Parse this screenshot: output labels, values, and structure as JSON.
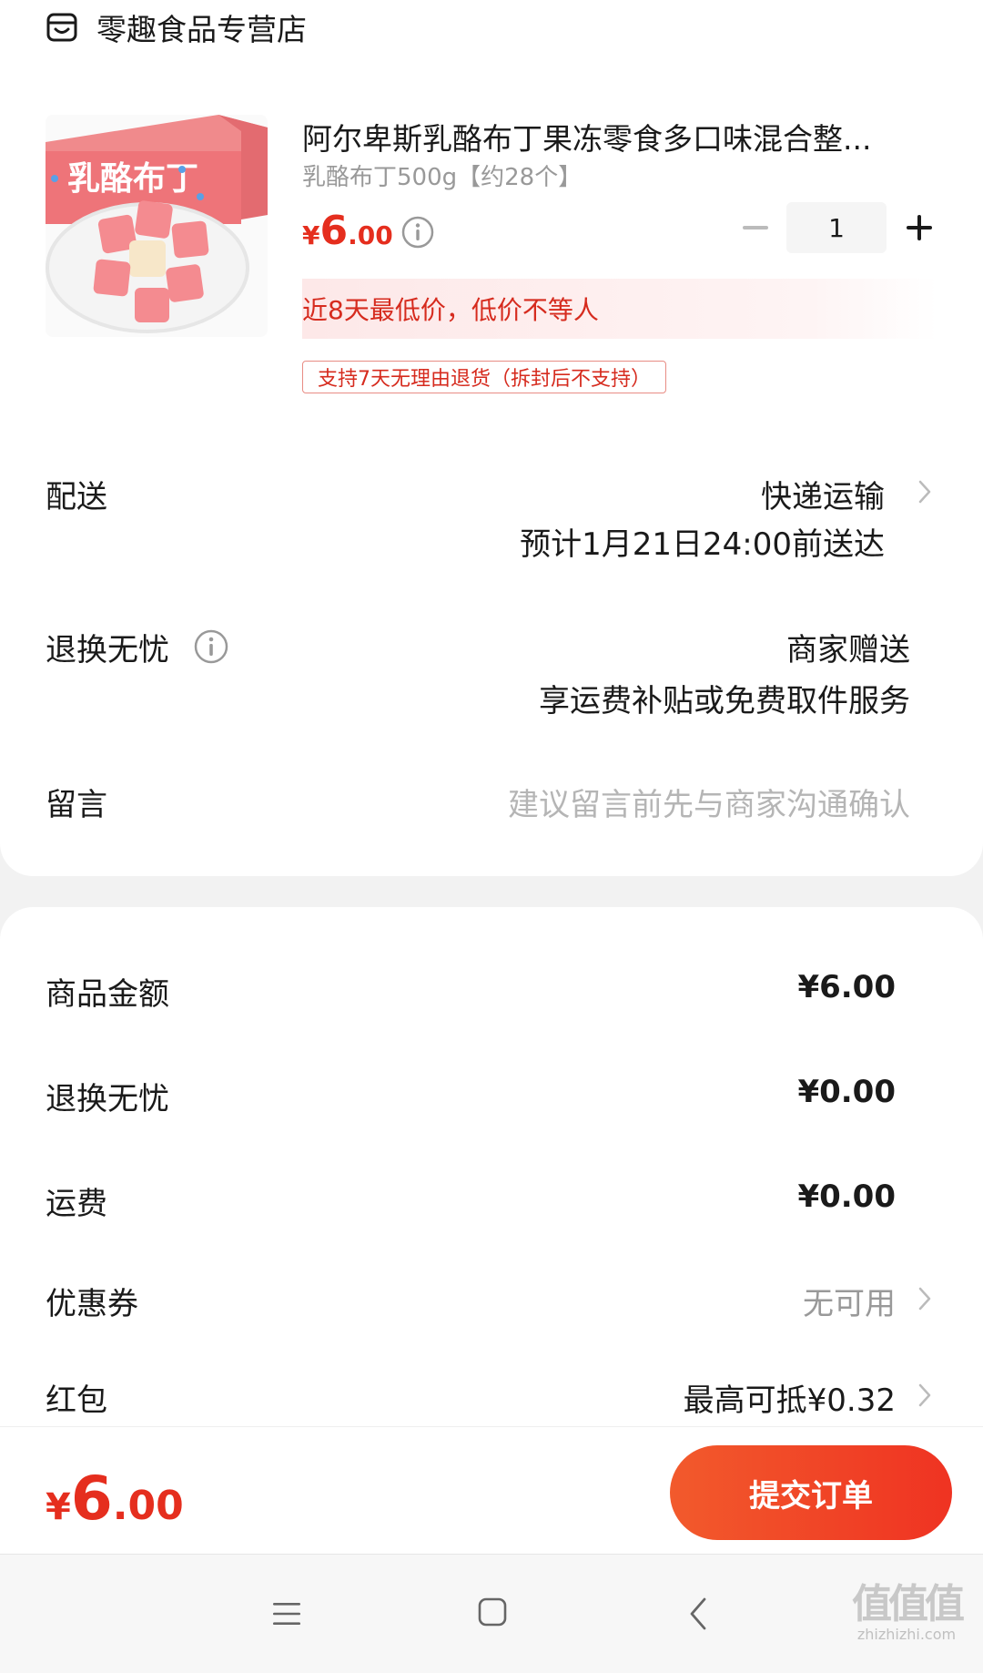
{
  "shop": {
    "name": "零趣食品专营店",
    "icon": "shop-icon"
  },
  "product": {
    "title": "阿尔卑斯乳酪布丁果冻零食多口味混合整...",
    "spec": "乳酪布丁500g【约28个】",
    "price": {
      "symbol": "¥",
      "integer": "6",
      "decimal": ".00"
    },
    "quantity": "1",
    "low_price_note": "近8天最低价，低价不等人",
    "return_badge": "支持7天无理由退货（拆封后不支持）",
    "image_texts": {
      "box_title": "乳酪布丁"
    }
  },
  "delivery": {
    "label": "配送",
    "method": "快递运输",
    "eta": "预计1月21日24:00前送达"
  },
  "return_service": {
    "label": "退换无忧",
    "value": "商家赠送",
    "desc": "享运费补贴或免费取件服务"
  },
  "message": {
    "label": "留言",
    "placeholder": "建议留言前先与商家沟通确认"
  },
  "summary": {
    "items": [
      {
        "label": "商品金额",
        "value": "¥6.00"
      },
      {
        "label": "退换无忧",
        "value": "¥0.00"
      },
      {
        "label": "运费",
        "value": "¥0.00"
      }
    ],
    "coupon": {
      "label": "优惠券",
      "value": "无可用"
    },
    "red_packet": {
      "label": "红包",
      "value": "最高可抵¥0.32"
    }
  },
  "checkout": {
    "total": {
      "symbol": "¥",
      "integer": "6",
      "decimal": ".00"
    },
    "submit_label": "提交订单"
  },
  "watermark": {
    "main": "值值值",
    "sub": "zhizhizhi.com"
  },
  "colors": {
    "accent": "#e52e1e",
    "button_start": "#f25a2c",
    "button_end": "#ef3322"
  }
}
